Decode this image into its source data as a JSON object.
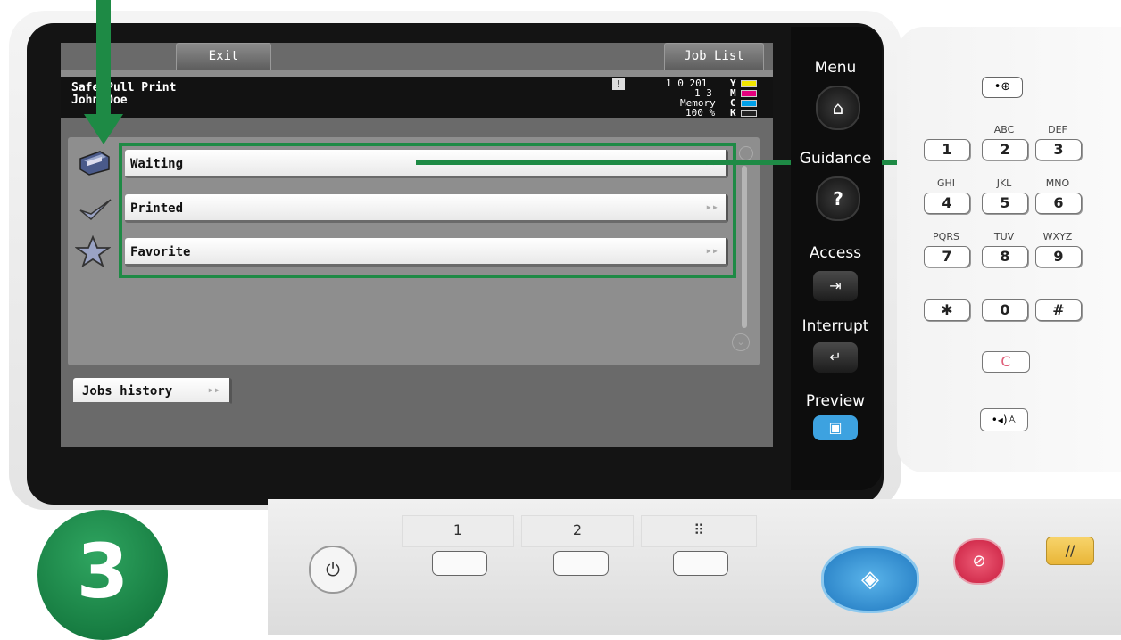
{
  "screen": {
    "exit_label": "Exit",
    "job_list_label": "Job List",
    "title_line1": "Safe Pull Print",
    "title_line2": "John Doe",
    "counter_line1": "1 0 201",
    "counter_line2": "1 3",
    "memory_label": "Memory",
    "memory_value": "100 %",
    "toner_letters": [
      "Y",
      "M",
      "C",
      "K"
    ],
    "toner_colors": [
      "#f2e600",
      "#e6007e",
      "#00a0e9",
      "#222222"
    ],
    "menu_items": [
      {
        "label": "Waiting",
        "icon": "printer-icon"
      },
      {
        "label": "Printed",
        "icon": "checkmark-icon"
      },
      {
        "label": "Favorite",
        "icon": "star-icon"
      }
    ],
    "jobs_history_label": "Jobs history",
    "arrow_glyph": "▸▸"
  },
  "hard_keys": {
    "menu_label": "Menu",
    "guidance_label": "Guidance",
    "access_label": "Access",
    "interrupt_label": "Interrupt",
    "preview_label": "Preview"
  },
  "keypad": {
    "keys": [
      {
        "num": "1",
        "sub": ""
      },
      {
        "num": "2",
        "sub": "ABC"
      },
      {
        "num": "3",
        "sub": "DEF"
      },
      {
        "num": "4",
        "sub": "GHI"
      },
      {
        "num": "5",
        "sub": "JKL"
      },
      {
        "num": "6",
        "sub": "MNO"
      },
      {
        "num": "7",
        "sub": "PQRS"
      },
      {
        "num": "8",
        "sub": "TUV"
      },
      {
        "num": "9",
        "sub": "WXYZ"
      },
      {
        "num": "✱",
        "sub": ""
      },
      {
        "num": "0",
        "sub": ""
      },
      {
        "num": "#",
        "sub": ""
      }
    ],
    "clear_label": "C"
  },
  "lower_panel": {
    "register_1": "1",
    "register_2": "2"
  },
  "step_number": "3",
  "colors": {
    "accent_green": "#1e8a45",
    "start_blue": "#2f8fd6",
    "stop_red": "#d8294a",
    "reset_yellow": "#f1c232"
  }
}
